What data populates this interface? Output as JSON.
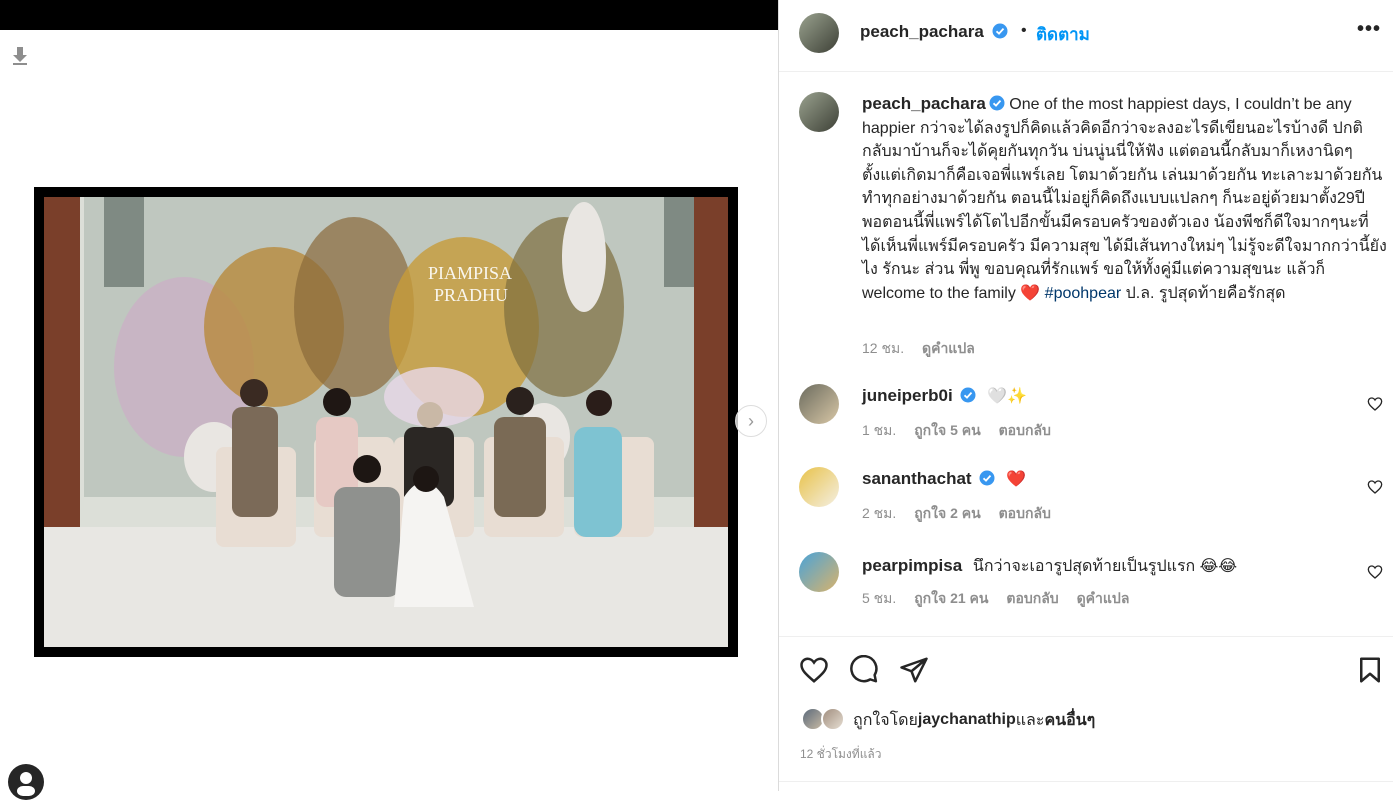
{
  "post": {
    "author": "peach_pachara",
    "follow_label": "ติดตาม",
    "dot": "•",
    "more_label": "•••",
    "next_label": "›",
    "caption_text": "One of the most happiest days, I couldn’t be any happier กว่าจะได้ลงรูปก็คิดแล้วคิดอีกว่าจะลงอะไรดีเขียนอะไรบ้างดี ปกติกลับมาบ้านก็จะได้คุยกันทุกวัน บ่นนู่นนี่ให้ฟัง แต่ตอนนี้กลับมาก็เหงานิดๆ ตั้งแต่เกิดมาก็คือเจอพี่แพร์เลย โตมาด้วยกัน เล่นมาด้วยกัน ทะเลาะมาด้วยกัน ทำทุกอย่างมาด้วยกัน ตอนนี้ไม่อยู่ก็คิดถึงแบบแปลกๆ ก็นะอยู่ด้วยมาตั้ง29ปี พอตอนนี้พี่แพร์ได้โตไปอีกขั้นมีครอบครัวของตัวเอง น้องพีชก็ดีใจมากๆนะที่ได้เห็นพี่แพร์มีครอบครัว มีความสุข ได้มีเส้นทางใหม่ๆ ไม่รู้จะดีใจมากกว่านี้ยังไง รักนะ ส่วน พี่พู ขอบคุณที่รักแพร์ ขอให้ทั้งคู่มีแต่ความสุขนะ แล้วก็ welcome to the family",
    "caption_heart": "❤️",
    "hashtag": "#poohpear",
    "caption_tail": " ป.ล. รูปสุดท้ายคือรักสุด",
    "caption_time": "12 ชม.",
    "translate_label": "ดูคำแปล",
    "photo_overlay_text_1": "PIAMPISA",
    "photo_overlay_text_2": "PRADHU"
  },
  "comments": [
    {
      "user": "juneiperb0i",
      "verified": true,
      "text": "🤍✨",
      "time": "1 ชม.",
      "likes": "ถูกใจ 5 คน",
      "reply": "ตอบกลับ",
      "translate": ""
    },
    {
      "user": "sananthachat",
      "verified": true,
      "text": "❤️",
      "time": "2 ชม.",
      "likes": "ถูกใจ 2 คน",
      "reply": "ตอบกลับ",
      "translate": ""
    },
    {
      "user": "pearpimpisa",
      "verified": false,
      "text": "นึกว่าจะเอารูปสุดท้ายเป็นรูปแรก 😂😂",
      "time": "5 ชม.",
      "likes": "ถูกใจ 21 คน",
      "reply": "ตอบกลับ",
      "translate": "ดูคำแปล"
    }
  ],
  "likes": {
    "prefix": "ถูกใจโดย ",
    "user": "jaychanathip",
    "middle": " และ",
    "others": "คนอื่นๆ"
  },
  "posted_time": "12 ชั่วโมงที่แล้ว",
  "icons": {
    "download": "download-arrow-icon",
    "verified": "verified-badge-icon",
    "heart": "heart-outline-icon",
    "comment": "comment-bubble-icon",
    "share": "paper-plane-icon",
    "save": "bookmark-icon",
    "next": "chevron-right-icon",
    "more": "ellipsis-icon"
  },
  "colors": {
    "accent": "#0095f6",
    "verified": "#3897f0",
    "hashtag": "#00376b",
    "muted": "#8e8e8e"
  }
}
